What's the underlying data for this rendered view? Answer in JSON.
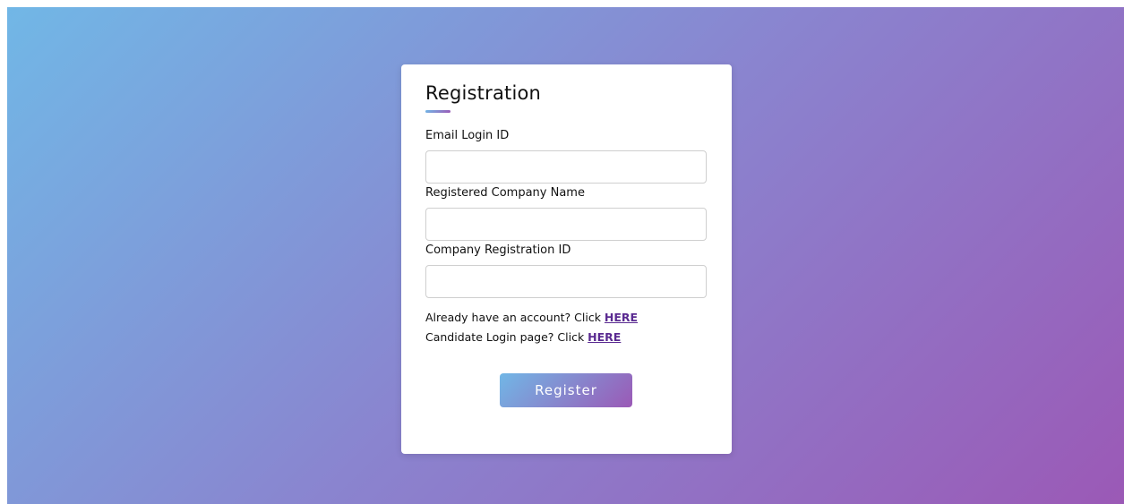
{
  "form": {
    "title": "Registration",
    "fields": [
      {
        "label": "Email Login ID",
        "value": "",
        "placeholder": ""
      },
      {
        "label": "Registered Company Name",
        "value": "",
        "placeholder": ""
      },
      {
        "label": "Company Registration ID",
        "value": "",
        "placeholder": ""
      }
    ],
    "links": [
      {
        "text": "Already have an account? Click ",
        "link_label": "HERE"
      },
      {
        "text": "Candidate Login page? Click ",
        "link_label": "HERE"
      }
    ],
    "submit_label": "Register"
  },
  "colors": {
    "gradient_start": "#71b7e6",
    "gradient_end": "#9b59b6",
    "link": "#5a2a91",
    "card_background": "#ffffff"
  }
}
